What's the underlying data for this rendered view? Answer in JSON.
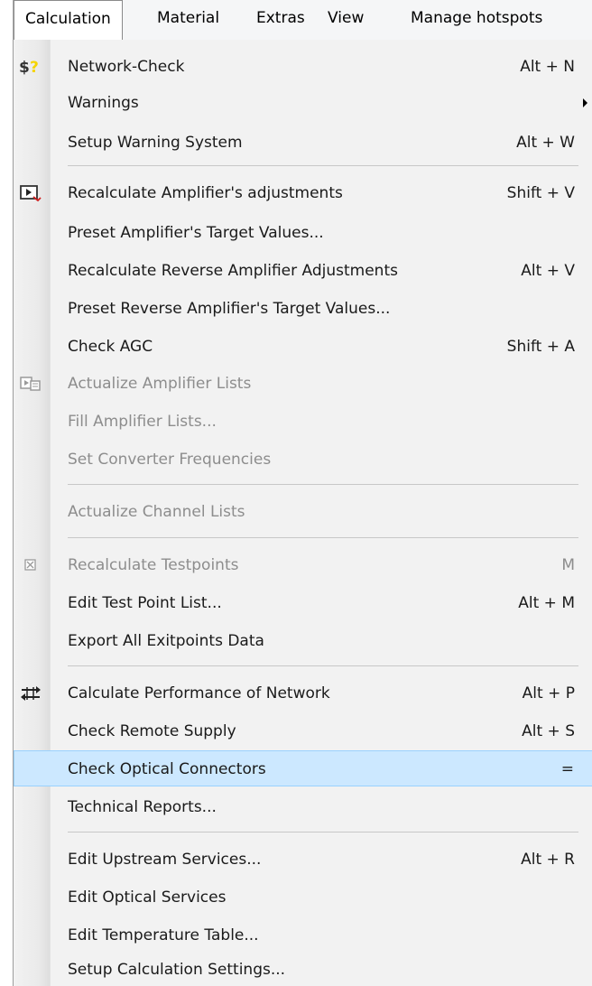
{
  "menubar": {
    "items": [
      "Calculation",
      "Material",
      "Extras",
      "View",
      "Manage hotspots"
    ]
  },
  "menu": {
    "network_check": {
      "label": "Network-Check",
      "shortcut": "Alt + N"
    },
    "warnings": {
      "label": "Warnings"
    },
    "setup_warning": {
      "label": "Setup Warning System",
      "shortcut": "Alt + W"
    },
    "recalc_amp": {
      "label": "Recalculate Amplifier's adjustments",
      "shortcut": "Shift + V"
    },
    "preset_amp": {
      "label": "Preset Amplifier's Target Values..."
    },
    "recalc_rev": {
      "label": "Recalculate Reverse Amplifier Adjustments",
      "shortcut": "Alt + V"
    },
    "preset_rev": {
      "label": "Preset Reverse Amplifier's Target Values..."
    },
    "check_agc": {
      "label": "Check AGC",
      "shortcut": "Shift + A"
    },
    "actualize_amp": {
      "label": "Actualize Amplifier Lists"
    },
    "fill_amp": {
      "label": "Fill Amplifier Lists..."
    },
    "set_conv": {
      "label": "Set Converter Frequencies"
    },
    "actualize_channel": {
      "label": "Actualize Channel Lists"
    },
    "recalc_test": {
      "label": "Recalculate Testpoints",
      "shortcut": "M"
    },
    "edit_test": {
      "label": "Edit Test Point List...",
      "shortcut": "Alt + M"
    },
    "export_exit": {
      "label": "Export All Exitpoints Data"
    },
    "calc_perf": {
      "label": "Calculate Performance of Network",
      "shortcut": "Alt + P"
    },
    "check_remote": {
      "label": "Check Remote Supply",
      "shortcut": "Alt + S"
    },
    "check_optical": {
      "label": "Check Optical Connectors",
      "shortcut": "="
    },
    "tech_reports": {
      "label": "Technical Reports..."
    },
    "edit_upstream": {
      "label": "Edit Upstream Services...",
      "shortcut": "Alt + R"
    },
    "edit_optical": {
      "label": "Edit Optical Services"
    },
    "edit_temp": {
      "label": "Edit Temperature Table..."
    },
    "setup_calc": {
      "label": "Setup Calculation Settings..."
    }
  },
  "colors": {
    "highlight": "#cce8ff",
    "highlight_border": "#99d1ff",
    "disabled_text": "#8d8d8d"
  }
}
